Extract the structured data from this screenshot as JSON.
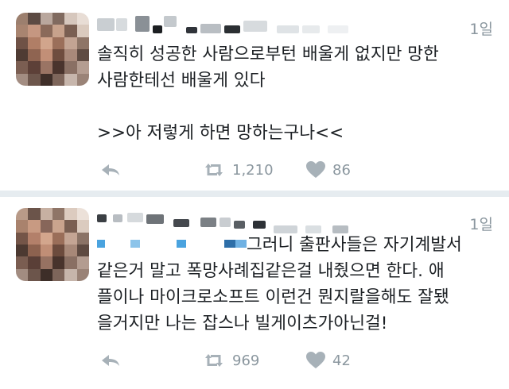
{
  "tweets": [
    {
      "time": "1일",
      "text": "솔직히 성공한 사람으로부턴 배울게 없지만 망한\n사람한테선 배울게 있다\n\n>>아 저렇게 하면 망하는구나<<",
      "actions": {
        "retweet_count": "1,210",
        "like_count": "86"
      }
    },
    {
      "time": "1일",
      "text_visible": "그러니 출판사들은 자기계발서\n같은거 말고 폭망사례집같은걸 내줬으면 한다. 애\n플이나 마이크로소프트 이런건 뭔지랄을해도 잘됐\n을거지만 나는 잡스나 빌게이츠가아닌걸!",
      "actions": {
        "retweet_count": "969",
        "like_count": "42"
      }
    }
  ],
  "colors": {
    "text": "#1c2024",
    "muted": "#8b979f",
    "background": "#e6ecf0",
    "card": "#ffffff",
    "mention_blue": "#4aa3df"
  },
  "icons": [
    "reply-icon",
    "retweet-icon",
    "heart-icon"
  ]
}
